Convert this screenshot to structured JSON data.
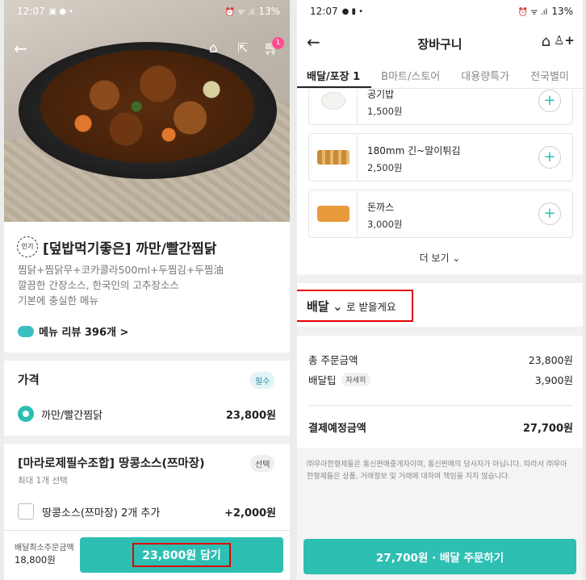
{
  "left": {
    "status": {
      "time": "12:07",
      "battery": "13%"
    },
    "cart_count": "1",
    "menu": {
      "badge": "인기",
      "title": "[덮밥먹기좋은] 까만/빨간찜닭",
      "desc_lines": [
        "찜닭+찜닭무+코카콜라500ml+두찜김+두찜油",
        "깔끔한 간장소스, 한국인의 고추장소스",
        "기본에 충실한 메뉴"
      ],
      "review": "메뉴 리뷰 396개 >"
    },
    "price_section": {
      "title": "가격",
      "tag": "필수",
      "option": "까만/빨간찜닭",
      "price": "23,800원"
    },
    "addon_section": {
      "title": "[마라로제필수조합] 땅콩소스(쯔마장)",
      "tag": "선택",
      "note": "최대 1개 선택",
      "option": "땅콩소스(쯔마장) 2개 추가",
      "price": "+2,000원"
    },
    "bottom": {
      "min_label": "배달최소주문금액",
      "min_value": "18,800원",
      "add_button": "23,800원 담기"
    }
  },
  "right": {
    "status": {
      "time": "12:07",
      "battery": "13%"
    },
    "header": {
      "title": "장바구니"
    },
    "tabs": [
      "배달/포장 1",
      "B마트/스토어",
      "대용량특가",
      "전국별미"
    ],
    "items": [
      {
        "name": "공기밥",
        "price": "1,500원"
      },
      {
        "name": "180mm 긴~말이튀김",
        "price": "2,500원"
      },
      {
        "name": "돈까스",
        "price": "3,000원"
      }
    ],
    "more": "더 보기",
    "delivery": {
      "mode": "배달",
      "suffix": "로 받을게요"
    },
    "summary": {
      "order_label": "총 주문금액",
      "order_value": "23,800원",
      "tip_label": "배달팁",
      "tip_badge": "자세히",
      "tip_value": "3,900원",
      "total_label": "결제예정금액",
      "total_value": "27,700원"
    },
    "notice": "㈜우아한형제들은 통신판매중개자이며, 통신판매의 당사자가 아닙니다. 따라서 ㈜우아한형제들은 상품, 거래정보 및 거래에 대하여 책임을 지지 않습니다.",
    "order_button": "27,700원 · 배달 주문하기"
  },
  "colors": {
    "accent": "#2ebfb3",
    "highlight": "#e00000",
    "badge": "#ff4d8d"
  },
  "icons": [
    "back-arrow-icon",
    "home-icon",
    "share-icon",
    "cart-icon",
    "add-person-icon",
    "plus-icon",
    "chevron-down-icon",
    "review-bubble-icon"
  ]
}
